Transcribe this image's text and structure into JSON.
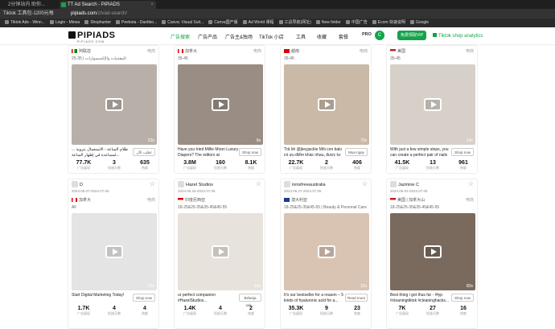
{
  "browser": {
    "tabs": [
      {
        "title": "2分钟站内 助你...",
        "active": false
      },
      {
        "title": "TT Ad Search - PiPiADS",
        "active": true
      }
    ],
    "url_left": "Tiktok 工具包-1200元每",
    "url_domain": "pipiads.com",
    "url_path": "/zh/ad-search/",
    "bookmarks": [
      "Tiktok Ads - Winn...",
      "Login - Minea",
      "Shophunter",
      "Peekota - Dashbo...",
      "Canva: Visual Suit...",
      "Canva国产版",
      "Ad World 课程",
      "工具导航(网址)",
      "New folder",
      "中国广告",
      "Ecom 快速说明",
      "Google"
    ]
  },
  "header": {
    "logo": "PIPIADS",
    "logo_sub": "PIPIADS.COM",
    "nav": [
      "广告搜索",
      "广告产品",
      "广告主&独场",
      "TikTok 小店",
      "工具",
      "收藏",
      "套餐"
    ],
    "pro": "PRO",
    "avatar_letter": "C",
    "free_btn": "免费领取VIP",
    "shop_analytics": "Tiktok shop analytics"
  },
  "cards": [
    {
      "advertiser": "",
      "date": "",
      "region": "阿联酋",
      "region_flag": "ae",
      "type": "电商",
      "audience": "25-35 | المقتنيات والإكسسوارات",
      "duration": "53s",
      "caption": "ظلام الساعة - الاستعمال بتروية ... لمساعدة في إظهار الساعة... ",
      "button": "اطلب الآن",
      "likes": "77.7K",
      "comments": "3",
      "shares": "635",
      "thumb": "#b8b0a8"
    },
    {
      "advertiser": "",
      "date": "",
      "region": "加拿大",
      "region_flag": "ca",
      "type": "电商",
      "audience": "35-45",
      "duration": "9s",
      "caption": "Have you tried Millie Moon Luxury Diapers? The editors at Motherly...",
      "button": "Shop now",
      "likes": "3.8M",
      "comments": "160",
      "shares": "8.1K",
      "thumb": "#9a8e84"
    },
    {
      "advertiser": "",
      "date": "",
      "region": "越南",
      "region_flag": "vn",
      "type": "电商",
      "audience": "35-45",
      "duration": "70s",
      "caption": "Trả lời @jkeyjackie Mỗi con balo có ưu điểm khác nhau, được tư vấn...",
      "button": "Mua ngay",
      "likes": "22.7K",
      "comments": "2",
      "shares": "406",
      "thumb": "#c9b9a6"
    },
    {
      "advertiser": "",
      "date": "",
      "region": "美国",
      "region_flag": "us",
      "type": "电商",
      "audience": "35-45",
      "duration": "14s",
      "caption": "With just a few simple steps, you can create a perfect pair of nails a...",
      "button": "Shop now",
      "likes": "41.5K",
      "comments": "13",
      "shares": "961",
      "thumb": "#d6d0c8"
    },
    {
      "advertiser": "D",
      "date": "2024.05.07-2024.07.05",
      "region": "加拿大",
      "region_flag": "ca",
      "type": "电商",
      "audience": "All",
      "duration": "12s",
      "caption": "Start Digital Marketing Today!",
      "button": "Shop now",
      "likes": "1.7K",
      "comments": "4",
      "shares": "4",
      "thumb": "#e4e4e4"
    },
    {
      "advertiser": "Hazel Studios",
      "date": "2024.06.26-2024.07.05",
      "region": "印度尼西亚",
      "region_flag": "id",
      "type": "",
      "audience": "18-25&25-35&35-45&45-55",
      "duration": "15s",
      "caption": "ur perfect companion #HazelStudios...",
      "button": "Belanja sek...",
      "likes": "1.4K",
      "comments": "4",
      "shares": "2",
      "thumb": "#e8e2dc"
    },
    {
      "advertiser": "innisfreeaustralia",
      "date": "2024.06.27-2024.07.05",
      "region": "澳大利亚",
      "region_flag": "au",
      "type": "",
      "audience": "18-25&25-35&45-55 | Beauty & Personal Care",
      "duration": "12s",
      "caption": "It's our bestseller for a reason – 5 kinds of hyaluronic acid for a...",
      "button": "Read more",
      "likes": "35.3K",
      "comments": "9",
      "shares": "23",
      "thumb": "#d9c4b4"
    },
    {
      "advertiser": "Jazmine C",
      "date": "2024.05.02-2024.07.05",
      "region": "美国 | 加拿大山",
      "region_flag": "us",
      "type": "电商",
      "audience": "18-25&25-35&35-45&45-55",
      "duration": "82s",
      "caption": "Best thing i got thus far - #fyp #cleaningtiktok #cleaninghacks...",
      "button": "Shop now",
      "likes": "7K",
      "comments": "27",
      "shares": "16",
      "thumb": "#7a6a5e"
    }
  ],
  "labels": {
    "likes": "广告展现",
    "comments": "投放天数",
    "shares": "热度"
  }
}
